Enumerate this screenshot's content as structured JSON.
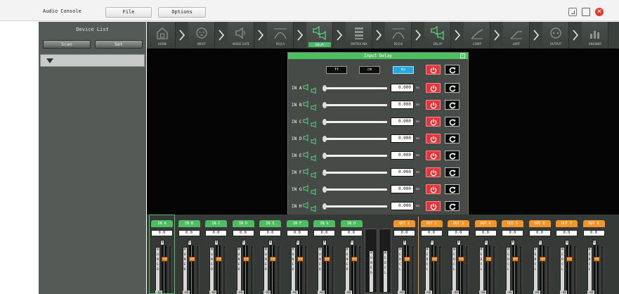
{
  "app": {
    "title": "Audio Console"
  },
  "menu": {
    "file": "File",
    "options": "Options"
  },
  "window": {
    "close_glyph": "✕"
  },
  "device": {
    "title": "Device List",
    "scan": "Scan",
    "set": "Set"
  },
  "nav": {
    "items": [
      {
        "label": "HOME",
        "icon": "home-icon"
      },
      {
        "label": "INPUT",
        "icon": "input-icon"
      },
      {
        "label": "NOISE GATE",
        "icon": "speaker-icon"
      },
      {
        "label": "PEQ-A",
        "icon": "eq-icon"
      },
      {
        "label": "DELAY",
        "icon": "delay-speaker-icon"
      },
      {
        "label": "MATRIX MIX",
        "icon": "matrix-icon"
      },
      {
        "label": "PEQ-B",
        "icon": "eq-icon"
      },
      {
        "label": "DELAY",
        "icon": "delay-speaker-icon"
      },
      {
        "label": "COMP",
        "icon": "comp-icon"
      },
      {
        "label": "LIMIT",
        "icon": "limit-icon"
      },
      {
        "label": "OUTPUT",
        "icon": "output-icon"
      },
      {
        "label": "ENGINER",
        "icon": "engineer-icon"
      }
    ],
    "active_index": 4
  },
  "dialog": {
    "title": "Input Delay",
    "close_glyph": "×",
    "units": [
      "ft",
      "cm",
      "ms"
    ],
    "selected_unit": "ms",
    "unit_suffix": "ms",
    "channels": [
      {
        "label": "IN A",
        "value": "0.000"
      },
      {
        "label": "IN B",
        "value": "0.000"
      },
      {
        "label": "IN C",
        "value": "0.000"
      },
      {
        "label": "IN D",
        "value": "0.000"
      },
      {
        "label": "IN E",
        "value": "0.000"
      },
      {
        "label": "IN F",
        "value": "0.000"
      },
      {
        "label": "IN G",
        "value": "0.000"
      },
      {
        "label": "IN H",
        "value": "0.000"
      }
    ]
  },
  "mixer": {
    "inputs": [
      {
        "label": "IN A",
        "value": "0.0"
      },
      {
        "label": "IN B",
        "value": "0.0"
      },
      {
        "label": "IN C",
        "value": "0.0"
      },
      {
        "label": "IN D",
        "value": "0.0"
      },
      {
        "label": "IN E",
        "value": "0.0"
      },
      {
        "label": "IN F",
        "value": "0.0"
      },
      {
        "label": "IN G",
        "value": "0.0"
      },
      {
        "label": "IN H",
        "value": "0.0"
      }
    ],
    "outputs": [
      {
        "label": "OUT 1",
        "value": "0.0"
      },
      {
        "label": "OUT 2",
        "value": "0.0"
      },
      {
        "label": "OUT 3",
        "value": "0.0"
      },
      {
        "label": "OUT 4",
        "value": "0.0"
      },
      {
        "label": "OUT 5",
        "value": "0.0"
      },
      {
        "label": "OUT 6",
        "value": "0.0"
      },
      {
        "label": "OUT 7",
        "value": "0.0"
      },
      {
        "label": "OUT 8",
        "value": "0.0"
      }
    ],
    "strip_top_button": "6",
    "strip_buttons_in": [
      "M",
      "U",
      "N",
      "E",
      "D"
    ],
    "strip_buttons_out": [
      "M",
      "E",
      "D",
      "C",
      "L"
    ],
    "center_col_a": [
      "M",
      "U",
      "N",
      "E",
      "D"
    ],
    "center_col_b": [
      "M",
      "E",
      "D",
      "C",
      "L"
    ],
    "strip_bottom": "-60",
    "colors": {
      "input_tab": "#4ebd62",
      "output_tab": "#f2952b",
      "fader": "#f0902b"
    }
  }
}
